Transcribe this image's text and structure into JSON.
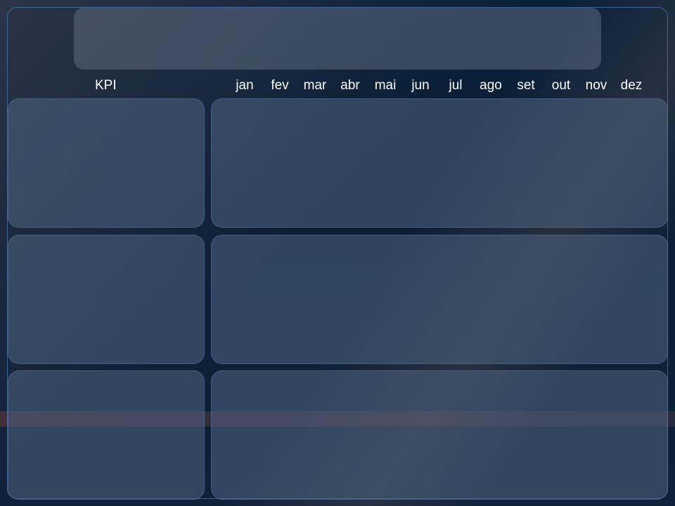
{
  "table": {
    "kpi_header": "KPI",
    "months": [
      "jan",
      "fev",
      "mar",
      "abr",
      "mai",
      "jun",
      "jul",
      "ago",
      "set",
      "out",
      "nov",
      "dez"
    ]
  },
  "rows": [
    {
      "kpi": "",
      "values": []
    },
    {
      "kpi": "",
      "values": []
    },
    {
      "kpi": "",
      "values": []
    }
  ]
}
